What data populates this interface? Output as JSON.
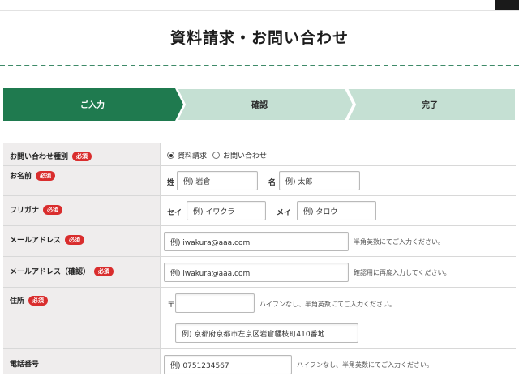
{
  "page": {
    "title": "資料請求・お問い合わせ"
  },
  "steps": [
    {
      "label": "ご入力",
      "active": true
    },
    {
      "label": "確認",
      "active": false
    },
    {
      "label": "完了",
      "active": false
    }
  ],
  "colors": {
    "active_step": "#1f7a4f",
    "inactive_step": "#c5e0d3",
    "required_badge": "#d92d2d",
    "dash": "#3e8a68"
  },
  "required_label": "必須",
  "form": {
    "inquiry_type": {
      "label": "お問い合わせ種別",
      "options": [
        "資料請求",
        "お問い合わせ"
      ],
      "selected": "資料請求"
    },
    "name": {
      "label": "お名前",
      "sei_label": "姓",
      "sei_placeholder": "例) 岩倉",
      "mei_label": "名",
      "mei_placeholder": "例) 太郎"
    },
    "furigana": {
      "label": "フリガナ",
      "sei_label": "セイ",
      "sei_placeholder": "例) イワクラ",
      "mei_label": "メイ",
      "mei_placeholder": "例) タロウ"
    },
    "email": {
      "label": "メールアドレス",
      "placeholder": "例) iwakura@aaa.com",
      "note": "半角英数にてご入力ください。"
    },
    "email_confirm": {
      "label": "メールアドレス（確認）",
      "placeholder": "例) iwakura@aaa.com",
      "note": "確認用に再度入力してください。"
    },
    "address": {
      "label": "住所",
      "postal_mark": "〒",
      "postal_note": "ハイフンなし、半角英数にてご入力ください。",
      "address_placeholder": "例) 京都府京都市左京区岩倉幡枝町410番地"
    },
    "phone": {
      "label": "電話番号",
      "placeholder": "例) 0751234567",
      "note": "ハイフンなし、半角英数にてご入力ください。"
    }
  }
}
